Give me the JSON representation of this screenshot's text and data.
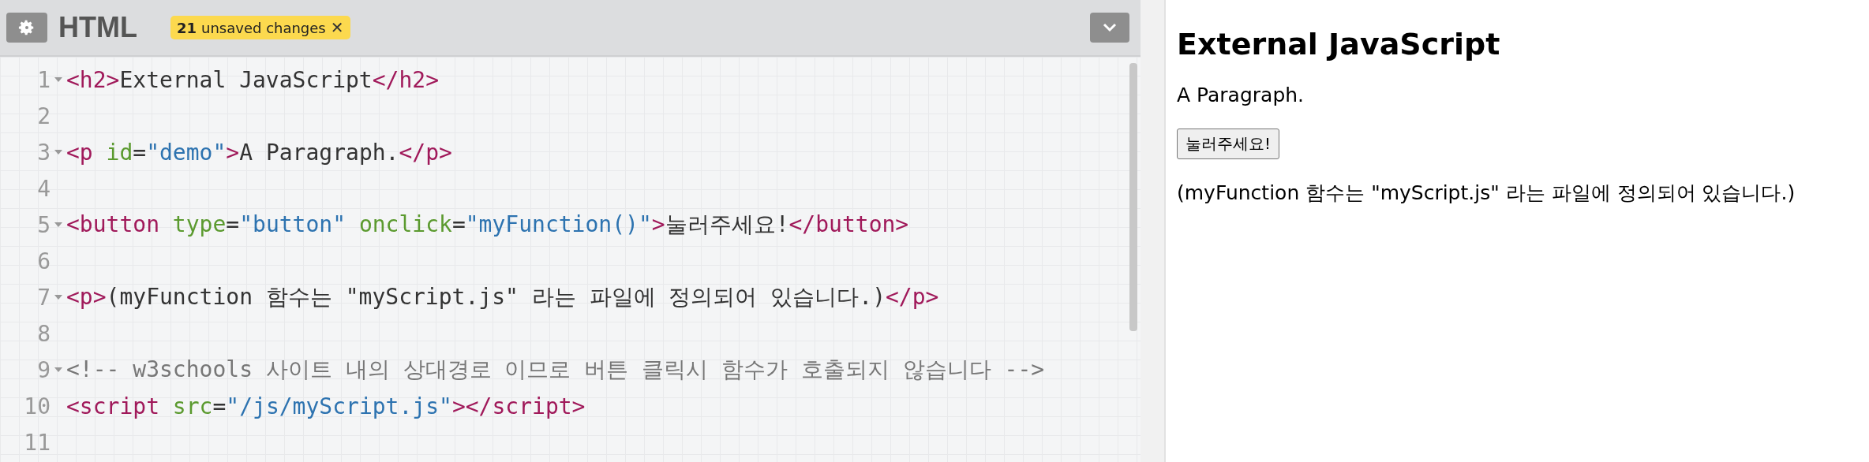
{
  "editor": {
    "title": "HTML",
    "badge": {
      "count": "21",
      "label": "unsaved changes",
      "close": "✕"
    },
    "lines": [
      {
        "number": "1",
        "foldable": true,
        "tokens": [
          {
            "kind": "tag",
            "text": "<h2>"
          },
          {
            "kind": "text",
            "text": "External JavaScript"
          },
          {
            "kind": "tag",
            "text": "</h2>"
          }
        ]
      },
      {
        "number": "2",
        "foldable": false
      },
      {
        "number": "3",
        "foldable": true,
        "tokens": [
          {
            "kind": "tag",
            "text": "<p"
          },
          {
            "kind": "attr",
            "text": " id"
          },
          {
            "kind": "text",
            "text": "="
          },
          {
            "kind": "value",
            "text": "\"demo\""
          },
          {
            "kind": "tag",
            "text": ">"
          },
          {
            "kind": "text",
            "text": "A Paragraph."
          },
          {
            "kind": "tag",
            "text": "</p>"
          }
        ]
      },
      {
        "number": "4",
        "foldable": false
      },
      {
        "number": "5",
        "foldable": true,
        "tokens": [
          {
            "kind": "tag",
            "text": "<button"
          },
          {
            "kind": "attr",
            "text": " type"
          },
          {
            "kind": "text",
            "text": "="
          },
          {
            "kind": "value",
            "text": "\"button\""
          },
          {
            "kind": "attr",
            "text": " onclick"
          },
          {
            "kind": "text",
            "text": "="
          },
          {
            "kind": "value",
            "text": "\"myFunction()\""
          },
          {
            "kind": "tag",
            "text": ">"
          },
          {
            "kind": "text",
            "text": "눌러주세요!"
          },
          {
            "kind": "tag",
            "text": "</button>"
          }
        ]
      },
      {
        "number": "6",
        "foldable": false
      },
      {
        "number": "7",
        "foldable": true,
        "tokens": [
          {
            "kind": "tag",
            "text": "<p>"
          },
          {
            "kind": "text",
            "text": "(myFunction 함수는 \"myScript.js\" 라는 파일에 정의되어 있습니다.)"
          },
          {
            "kind": "tag",
            "text": "</p>"
          }
        ]
      },
      {
        "number": "8",
        "foldable": false
      },
      {
        "number": "9",
        "foldable": true,
        "tokens": [
          {
            "kind": "comment",
            "text": "<!-- w3schools 사이트 내의 상대경로 이므로 버튼 클릭시 함수가 호출되지 않습니다 -->"
          }
        ]
      },
      {
        "number": "10",
        "foldable": false,
        "tokens": [
          {
            "kind": "tag",
            "text": "<script"
          },
          {
            "kind": "attr",
            "text": " src"
          },
          {
            "kind": "text",
            "text": "="
          },
          {
            "kind": "value",
            "text": "\"/js/myScript.js\""
          },
          {
            "kind": "tag",
            "text": ">"
          },
          {
            "kind": "tag",
            "text": "</script>"
          }
        ]
      },
      {
        "number": "11",
        "foldable": false
      }
    ]
  },
  "preview": {
    "heading": "External JavaScript",
    "paragraph": "A Paragraph.",
    "button": "눌러주세요!",
    "note": "(myFunction 함수는 \"myScript.js\" 라는 파일에 정의되어 있습니다.)"
  }
}
